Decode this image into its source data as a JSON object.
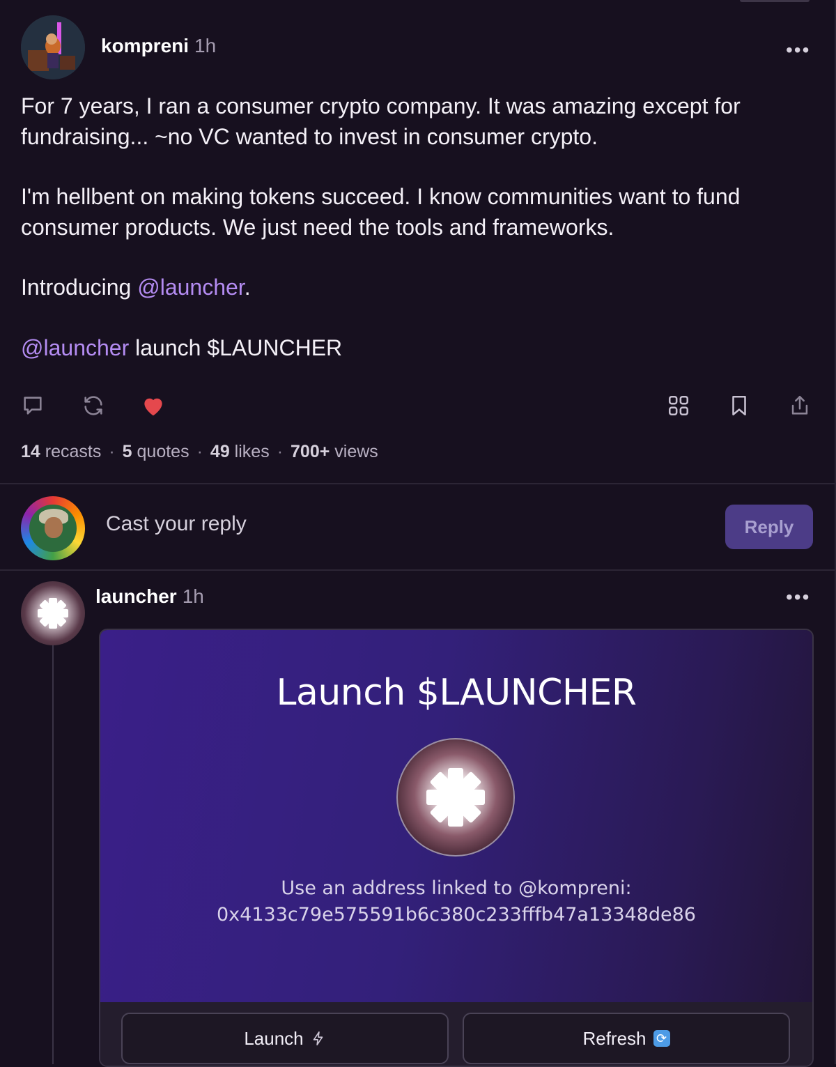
{
  "main_cast": {
    "author": "kompreni",
    "time": "1h",
    "more": "•••",
    "paragraphs": {
      "p1": "For 7 years, I ran a consumer crypto company. It was amazing except for fundraising... ~no VC wanted to invest in consumer crypto.",
      "p2": "I'm hellbent on making tokens succeed. I know communities want to fund consumer products. We just need the tools and frameworks.",
      "p3_prefix": "Introducing ",
      "p3_mention": "@launcher",
      "p3_suffix": ".",
      "p4_mention": "@launcher",
      "p4_suffix": " launch $LAUNCHER"
    },
    "actions": [
      "comment-icon",
      "recast-icon",
      "heart-icon",
      "grid-icon",
      "bookmark-icon",
      "share-icon"
    ],
    "liked": true,
    "like_color": "#e5484d",
    "stats": {
      "recasts_count": "14",
      "recasts_label": " recasts",
      "quotes_count": "5",
      "quotes_label": " quotes",
      "likes_count": "49",
      "likes_label": " likes",
      "views_count": "700+",
      "views_label": " views"
    }
  },
  "reply_box": {
    "placeholder": "Cast your reply",
    "button_label": "Reply"
  },
  "reply_cast": {
    "author": "launcher",
    "time": "1h",
    "more": "•••",
    "frame": {
      "title": "Launch $LAUNCHER",
      "caption_line1": "Use an address linked to @kompreni:",
      "caption_line2": "0x4133c79e575591b6c380c233fffb47a13348de86",
      "buttons": {
        "launch_label": "Launch",
        "refresh_label": "Refresh"
      }
    }
  },
  "colors": {
    "background": "#17101f",
    "mention": "#b48cf2",
    "reply_button": "#4c3c87",
    "frame_gradient_start": "#3a1f88"
  }
}
